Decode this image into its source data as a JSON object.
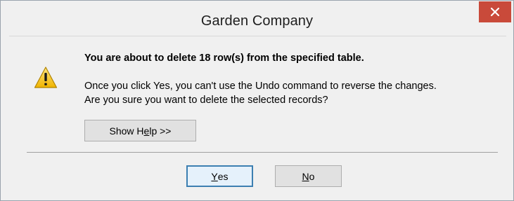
{
  "window": {
    "title": "Garden Company",
    "close_glyph": "×"
  },
  "message": {
    "heading": "You are about to delete 18 row(s) from the specified table.",
    "line1": "Once you click Yes, you can't use the Undo command to reverse the changes.",
    "line2": "Are you sure you want to delete the selected records?"
  },
  "buttons": {
    "help_pre": "Show H",
    "help_mnemonic": "e",
    "help_post": "lp >>",
    "yes_mnemonic": "Y",
    "yes_rest": "es",
    "no_mnemonic": "N",
    "no_rest": "o"
  },
  "icons": {
    "warning": "warning-triangle-icon",
    "close": "close-icon"
  },
  "colors": {
    "close_button": "#c94a3a",
    "default_button_border": "#3c7fb1",
    "default_button_fill": "#e5f1fb",
    "warning_yellow": "#f5c518"
  }
}
